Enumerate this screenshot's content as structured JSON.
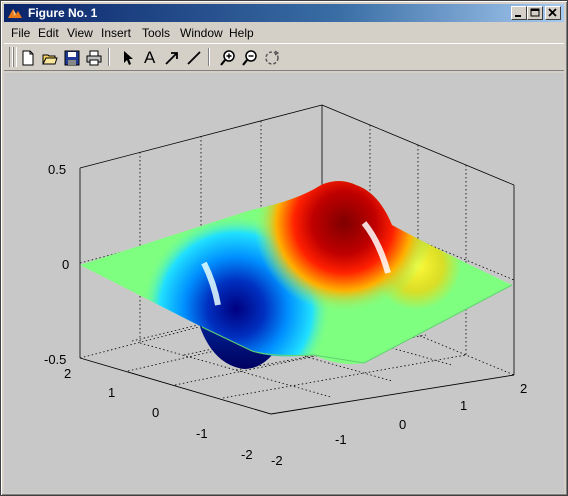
{
  "window": {
    "title": "Figure No. 1",
    "app_icon": "matlab-logo-icon",
    "buttons": [
      "minimize-icon",
      "maximize-icon",
      "close-icon"
    ]
  },
  "menu": {
    "items": [
      {
        "label": "File"
      },
      {
        "label": "Edit"
      },
      {
        "label": "View"
      },
      {
        "label": "Insert"
      },
      {
        "label": "Tools"
      },
      {
        "label": "Window"
      },
      {
        "label": "Help"
      }
    ]
  },
  "toolbar": {
    "buttons": [
      "new-file-icon",
      "open-folder-icon",
      "save-icon",
      "print-icon",
      "select-arrow-icon",
      "insert-text-icon",
      "insert-arrow-icon",
      "insert-line-icon",
      "zoom-in-icon",
      "zoom-out-icon",
      "rotate-3d-icon"
    ],
    "text_tool_label": "A"
  },
  "plot": {
    "type": "3-D surface",
    "colormap": "jet",
    "background": "#c8c8c8",
    "z_ticks": [
      "0.5",
      "0",
      "-0.5"
    ],
    "y_ticks": [
      "2",
      "1",
      "0",
      "-1",
      "-2"
    ],
    "x_ticks": [
      "-2",
      "-1",
      "0",
      "1",
      "2"
    ],
    "zlim": [
      -0.5,
      0.5
    ],
    "xlim": [
      -2,
      2
    ],
    "ylim": [
      -2,
      2
    ],
    "grid": "on"
  }
}
